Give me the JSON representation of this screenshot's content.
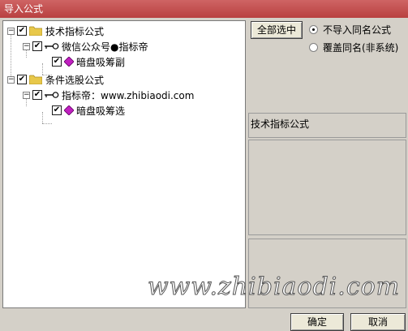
{
  "window": {
    "title": "导入公式"
  },
  "tree": {
    "groups": [
      {
        "label": "技术指标公式",
        "checked": true,
        "items": [
          {
            "label": "微信公众号●指标帝",
            "checked": true,
            "children": [
              {
                "label": "暗盘吸筹副",
                "checked": true
              }
            ]
          }
        ]
      },
      {
        "label": "条件选股公式",
        "checked": true,
        "items": [
          {
            "label": "指标帝：www.zhibiaodi.com",
            "checked": true,
            "children": [
              {
                "label": "暗盘吸筹选",
                "checked": true
              }
            ]
          }
        ]
      }
    ]
  },
  "options": {
    "select_all_label": "全部选中",
    "radio_no_import": "不导入同名公式",
    "radio_overwrite": "覆盖同名(非系统)",
    "selected": "no_import"
  },
  "info": {
    "category_text": "技术指标公式"
  },
  "footer": {
    "ok_label": "确定",
    "cancel_label": "取消"
  },
  "watermark": "www.zhibiaodi.com",
  "colors": {
    "titlebar": "#c0504d",
    "gem": "#c020c0",
    "folder": "#e8c84a"
  }
}
